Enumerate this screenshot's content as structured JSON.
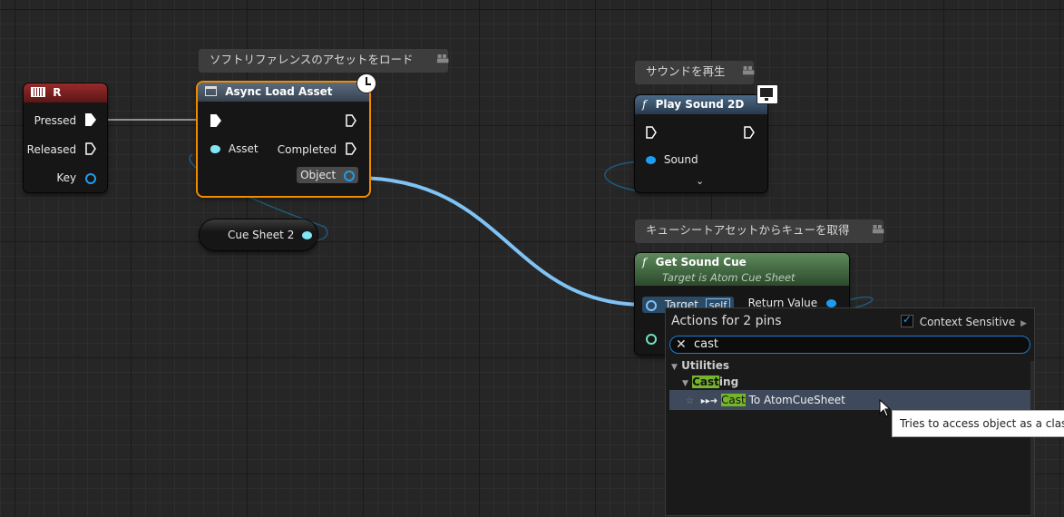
{
  "comments": {
    "async_load": "ソフトリファレンスのアセットをロード",
    "play_sound": "サウンドを再生",
    "get_cue": "キューシートアセットからキューを取得"
  },
  "node_r": {
    "title": "R",
    "pins": [
      "Pressed",
      "Released",
      "Key"
    ]
  },
  "node_async": {
    "title": "Async Load Asset",
    "asset_pin": "Asset",
    "completed_pin": "Completed",
    "object_pin": "Object"
  },
  "node_cuesheet": {
    "label": "Cue Sheet 2"
  },
  "node_play": {
    "title": "Play Sound 2D",
    "sound_pin": "Sound"
  },
  "node_getcue": {
    "title": "Get Sound Cue",
    "subtitle": "Target is Atom Cue Sheet",
    "target_pin": "Target",
    "self_badge": "self",
    "return_pin": "Return Value"
  },
  "popup": {
    "title": "Actions for 2 pins",
    "context_label": "Context Sensitive",
    "search_value": "cast",
    "category": "Utilities",
    "subcategory_hl": "Cast",
    "subcategory_rest": "ing",
    "item_hl": "Cast",
    "item_rest": " To AtomCueSheet"
  },
  "tooltip": {
    "text": "Tries to access object as a class 'A"
  },
  "colors": {
    "exec": "#ffffff",
    "object": "#1e9cf0",
    "accent_select": "#f08a00",
    "wire_object": "#7fc3f5"
  }
}
